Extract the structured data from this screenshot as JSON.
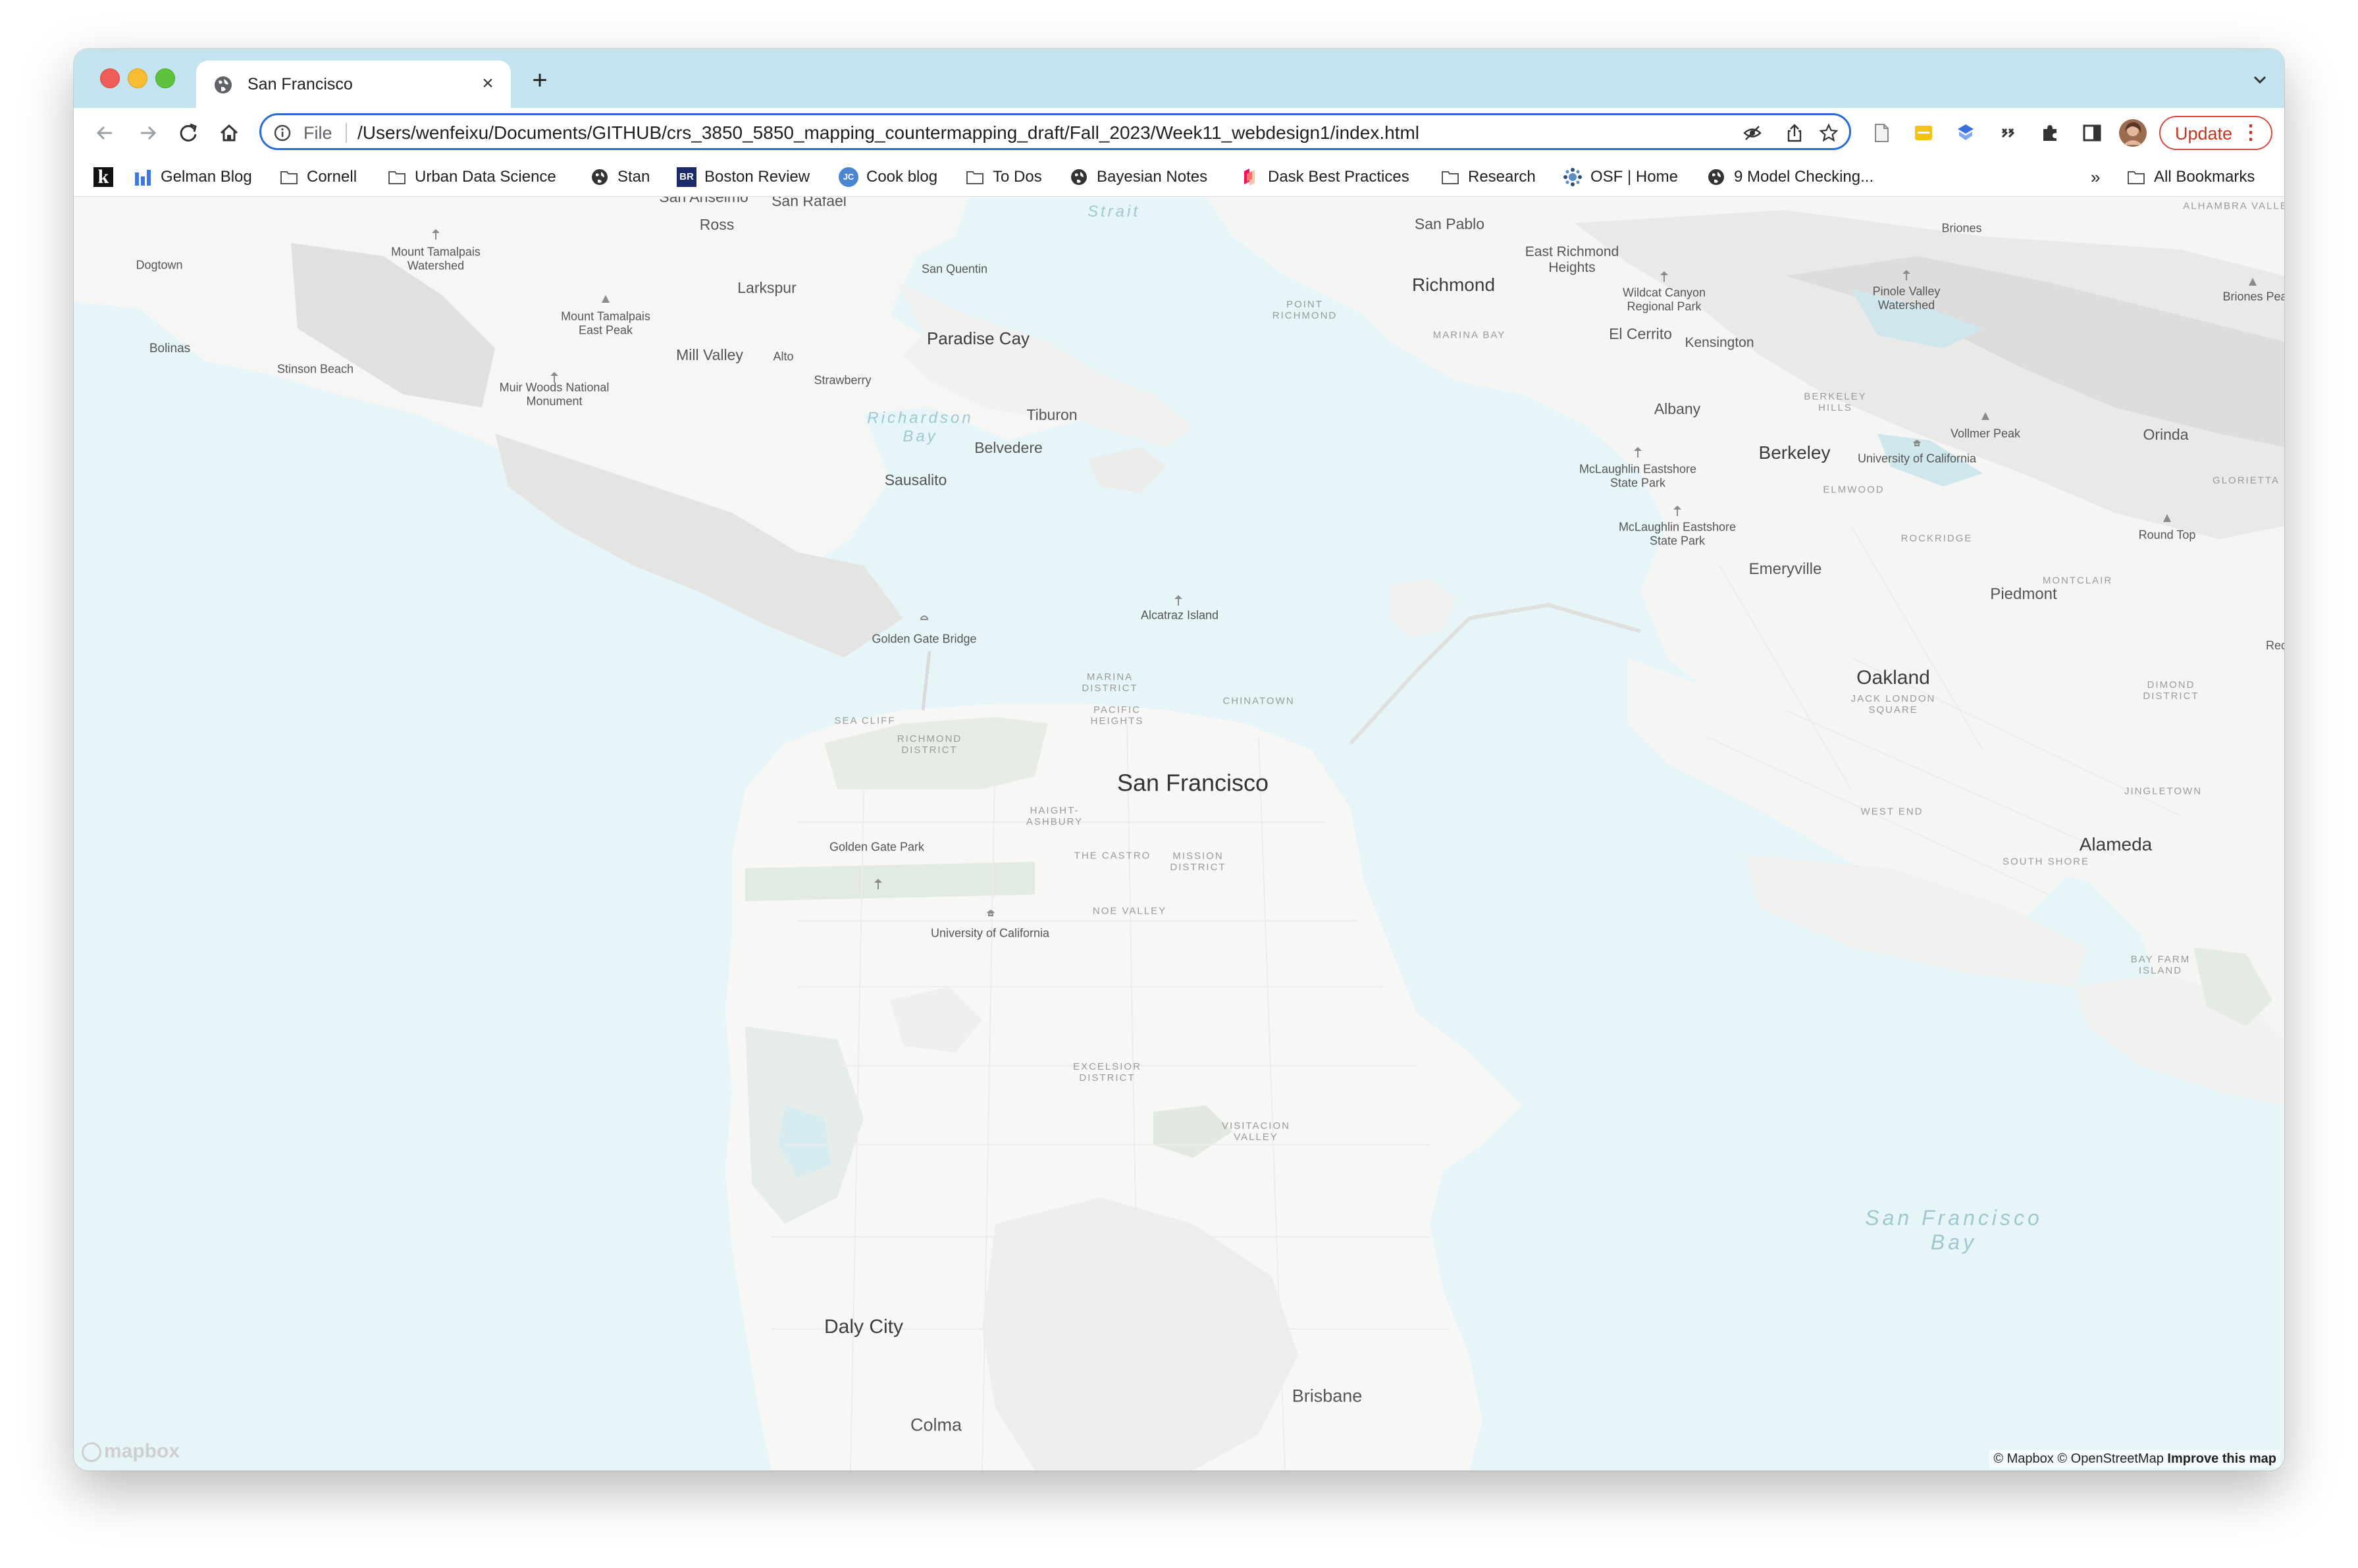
{
  "tab": {
    "title": "San Francisco",
    "close_glyph": "×",
    "new_tab_glyph": "+"
  },
  "toolbar": {
    "scheme_label": "File",
    "url": "/Users/wenfeixu/Documents/GITHUB/crs_3850_5850_mapping_countermapping_draft/Fall_2023/Week11_webdesign1/index.html",
    "update_label": "Update",
    "menu_glyph": "⋮"
  },
  "bookmarks": {
    "items": [
      "Gelman Blog",
      "Cornell",
      "Urban Data Science",
      "Stan",
      "Boston Review",
      "Cook blog",
      "To Dos",
      "Bayesian Notes",
      "Dask Best Practices",
      "Research",
      "OSF | Home",
      "9 Model Checking..."
    ],
    "overflow": "»",
    "all_label": "All Bookmarks",
    "k_logo": "k",
    "br_logo": "BR",
    "jc_logo": "JC"
  },
  "map": {
    "labels": {
      "san_anselmo": "San Anselmo",
      "san_rafael": "San Rafael",
      "strait": "Strait",
      "san_pablo": "San Pablo",
      "ross": "Ross",
      "san_quentin": "San Quentin",
      "briones": "Briones",
      "alhambra": "ALHAMBRA VALLEY",
      "dogtown": "Dogtown",
      "mt_tam_watershed": "Mount Tamalpais Watershed",
      "larkspur": "Larkspur",
      "richmond": "Richmond",
      "east_richmond": "East Richmond Heights",
      "wildcat": "Wildcat Canyon Regional Park",
      "pinole": "Pinole Valley Watershed",
      "briones_peak": "Briones Peak",
      "point_richmond": "POINT RICHMOND",
      "marina_bay": "MARINA BAY",
      "mt_tam_east": "Mount Tamalpais East Peak",
      "bolinas": "Bolinas",
      "mill_valley": "Mill Valley",
      "alto": "Alto",
      "paradise_cay": "Paradise Cay",
      "el_cerrito": "El Cerrito",
      "kensington": "Kensington",
      "stinson": "Stinson Beach",
      "strawberry": "Strawberry",
      "muir": "Muir Woods National Monument",
      "richardson": "Richardson Bay",
      "tiburon": "Tiburon",
      "albany": "Albany",
      "berkeley_hills": "BERKELEY HILLS",
      "vollmer": "Vollmer Peak",
      "orinda": "Orinda",
      "belvedere": "Belvedere",
      "berkeley": "Berkeley",
      "ucb": "University of California",
      "mclaughlin1": "McLaughlin Eastshore State Park",
      "glorietta": "GLORIETTA",
      "sausalito": "Sausalito",
      "elmwood": "ELMWOOD",
      "mclaughlin2": "McLaughlin Eastshore State Park",
      "rockridge": "ROCKRIDGE",
      "round_top": "Round Top",
      "emeryville": "Emeryville",
      "montclair": "MONTCLAIR",
      "alcatraz": "Alcatraz Island",
      "piedmont": "Piedmont",
      "golden_gate_bridge": "Golden Gate Bridge",
      "rec": "Rec",
      "marina": "MARINA DISTRICT",
      "oakland": "Oakland",
      "jack_london": "JACK LONDON SQUARE",
      "chinatown": "CHINATOWN",
      "dimond": "DIMOND DISTRICT",
      "pacific_heights": "PACIFIC HEIGHTS",
      "sea_cliff": "SEA CLIFF",
      "richmond_district": "RICHMOND DISTRICT",
      "san_francisco": "San Francisco",
      "jingletown": "JINGLETOWN",
      "west_end": "WEST END",
      "haight": "HAIGHT-ASHBURY",
      "alameda": "Alameda",
      "ggpark": "Golden Gate Park",
      "the_castro": "THE CASTRO",
      "mission": "MISSION DISTRICT",
      "south_shore": "SOUTH SHORE",
      "ucsf": "University of California",
      "noe": "NOE VALLEY",
      "bay_farm": "BAY FARM ISLAND",
      "excelsior": "EXCELSIOR DISTRICT",
      "visitacion": "VISITACION VALLEY",
      "sf_bay": "San Francisco Bay",
      "daly_city": "Daly City",
      "brisbane": "Brisbane",
      "colma": "Colma"
    },
    "logo": "mapbox",
    "attribution_mapbox": "© Mapbox",
    "attribution_osm": "© OpenStreetMap",
    "attribution_improve": "Improve this map"
  }
}
